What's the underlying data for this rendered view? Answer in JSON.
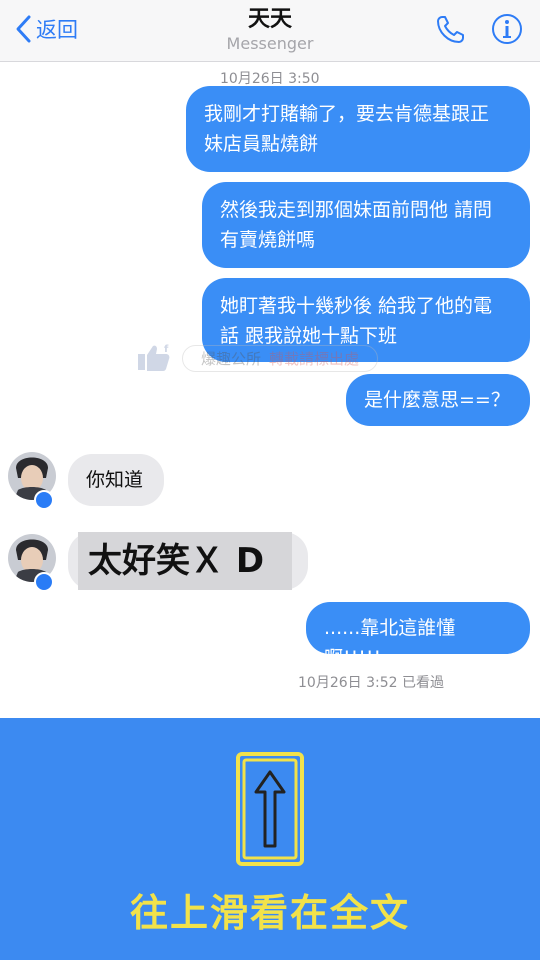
{
  "header": {
    "back_label": "返回",
    "title": "天天",
    "subtitle": "Messenger",
    "back_icon": "chevron-left-icon",
    "phone_icon": "phone-icon",
    "info_icon": "info-icon"
  },
  "messages": [
    {
      "from": "me",
      "lines": [
        "我剛才打賭輸了，要去肯德基跟正",
        "妹店員點燒餅"
      ]
    },
    {
      "from": "me",
      "lines": [
        "然後我走到那個妹面前問他 請問",
        "有賣燒餅嗎"
      ]
    },
    {
      "from": "me",
      "lines": [
        "她盯著我十幾秒後 給我了他的電",
        "話 跟我說她十點下班"
      ]
    },
    {
      "from": "me",
      "lines": [
        "是什麼意思==？"
      ]
    },
    {
      "from": "them",
      "lines": [
        "你知道"
      ]
    },
    {
      "from": "them",
      "lines": [
        "太好笑Ｘ D"
      ]
    },
    {
      "from": "me",
      "lines": [
        "......靠北這誰懂啊!!!!!"
      ]
    }
  ],
  "timestamps": {
    "top": "10月26日 3:50",
    "bottom": "10月26日 3:52 已看過"
  },
  "watermark": {
    "text": "爆趣公所",
    "note": "轉載請標出處"
  },
  "banner": {
    "cta": "往上滑看在全文",
    "arrow_icon": "arrow-up-icon"
  },
  "colors": {
    "accent": "#2e7cf6",
    "my_bubble": "#3a8ef6",
    "their_bubble": "#e9e9ec",
    "banner_bg": "#3c8af1",
    "cta_text": "#f2e24a"
  }
}
